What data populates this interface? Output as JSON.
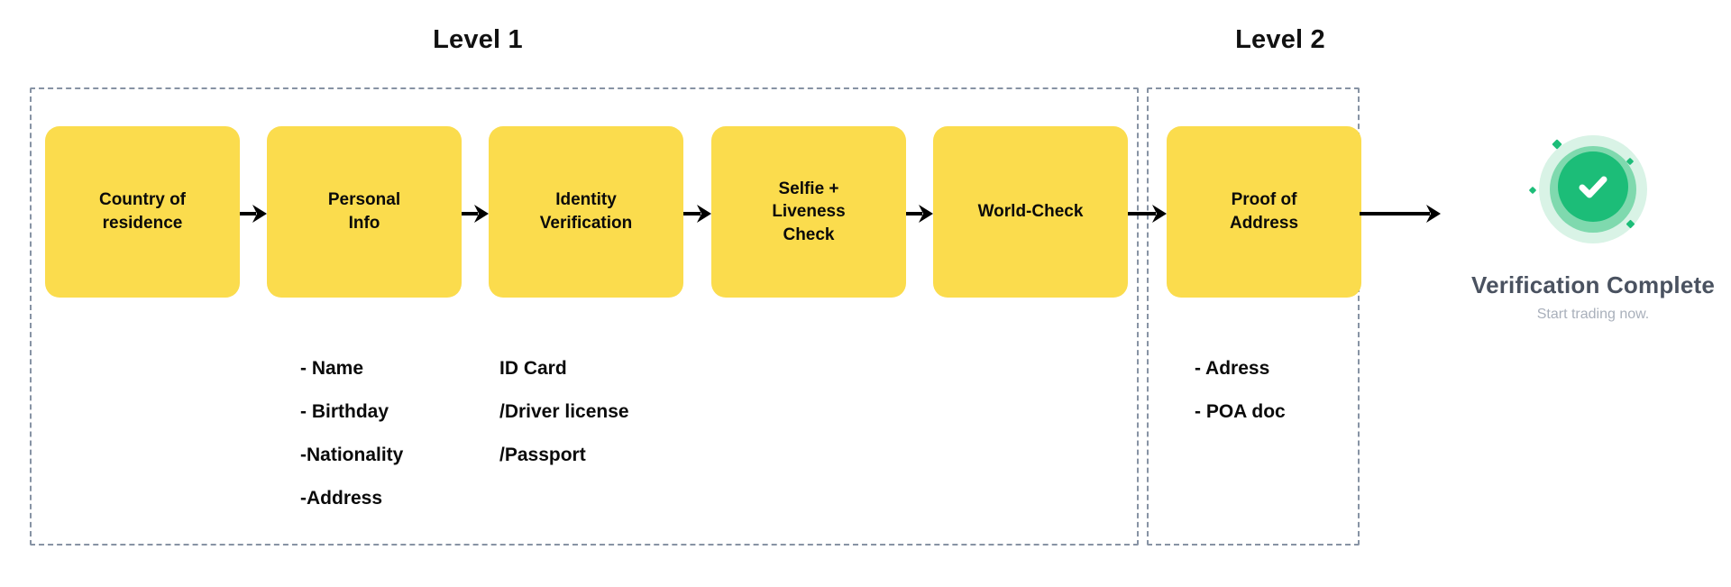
{
  "levels": [
    {
      "id": "level1",
      "label": "Level 1"
    },
    {
      "id": "level2",
      "label": "Level 2"
    }
  ],
  "steps": [
    {
      "id": "country-of-residence",
      "label": "Country of\nresidence"
    },
    {
      "id": "personal-info",
      "label": "Personal\nInfo"
    },
    {
      "id": "identity-verification",
      "label": "Identity\nVerification"
    },
    {
      "id": "selfie-liveness-check",
      "label": "Selfie +\nLiveness\nCheck"
    },
    {
      "id": "world-check",
      "label": "World-Check"
    },
    {
      "id": "proof-of-address",
      "label": "Proof of\nAddress"
    }
  ],
  "details": {
    "personal_info": "- Name\n- Birthday\n-Nationality\n-Address",
    "identity_verification": "ID Card\n/Driver license\n/Passport",
    "proof_of_address": "- Adress\n- POA doc"
  },
  "verification": {
    "icon": "check-circle-icon",
    "title": "Verification Complete",
    "subtitle": "Start trading now."
  },
  "colors": {
    "step_fill": "#fbdc4d",
    "dashed_border": "#8793a4",
    "success_core": "#1cbd78",
    "success_mid": "#7fd9ae",
    "success_glow": "#d9f3e6",
    "title_text": "#4a5260",
    "subtitle_text": "#a9b0bb"
  }
}
